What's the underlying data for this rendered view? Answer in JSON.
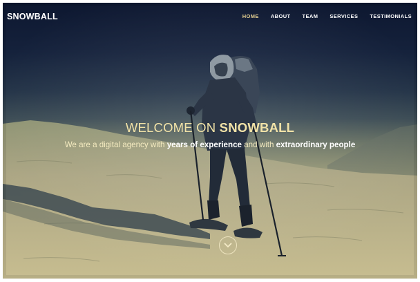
{
  "brand": {
    "name": "SNOWBALL"
  },
  "nav": {
    "items": [
      {
        "label": "HOME",
        "active": true
      },
      {
        "label": "ABOUT",
        "active": false
      },
      {
        "label": "TEAM",
        "active": false
      },
      {
        "label": "SERVICES",
        "active": false
      },
      {
        "label": "TESTIMONIALS",
        "active": false
      }
    ]
  },
  "hero": {
    "title_prefix": "WELCOME ON ",
    "title_highlight": "SNOWBALL",
    "subtitle_part1": "We are a digital agency with ",
    "subtitle_bold1": "years of experience",
    "subtitle_part2": " and with ",
    "subtitle_bold2": "extraordinary people",
    "scroll_icon": "chevron-down-icon"
  },
  "colors": {
    "nav_active": "#e3cf91",
    "title": "#f1e2a7",
    "sky_dark": "#0d1730",
    "snow": "#c9bf92"
  }
}
